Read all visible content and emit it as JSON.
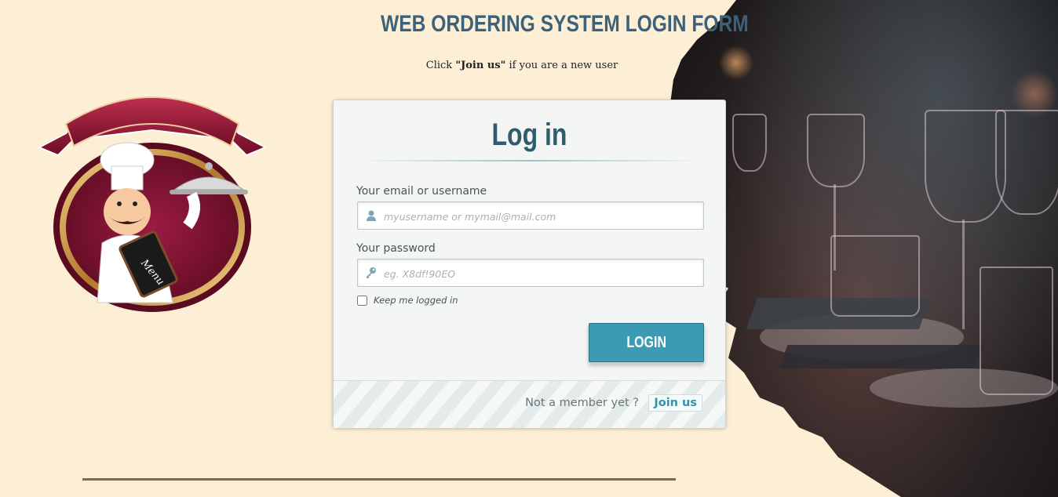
{
  "header": {
    "title": "WEB ORDERING SYSTEM LOGIN FORM",
    "subtitle_prefix": "Click ",
    "subtitle_emphasis": "\"Join us\"",
    "subtitle_suffix": " if you are a new user"
  },
  "logo": {
    "icon": "chef-with-menu-logo",
    "menu_text": "Menu"
  },
  "login_card": {
    "title": "Log in",
    "username": {
      "label": "Your email or username",
      "placeholder": "myusername or mymail@mail.com",
      "icon": "user-icon"
    },
    "password": {
      "label": "Your password",
      "placeholder": "eg. X8df!90EO",
      "icon": "key-icon"
    },
    "remember_me": {
      "label": "Keep me logged in",
      "checked": false
    },
    "login_button": "LOGIN",
    "footer": {
      "prompt": "Not a member yet ?",
      "join_link": "Join us"
    }
  },
  "colors": {
    "page_background": "#fdefd6",
    "title": "#3d6178",
    "button": "#3c9bb2",
    "link": "#2f95ad",
    "logo_ribbon": "#8e1436"
  }
}
